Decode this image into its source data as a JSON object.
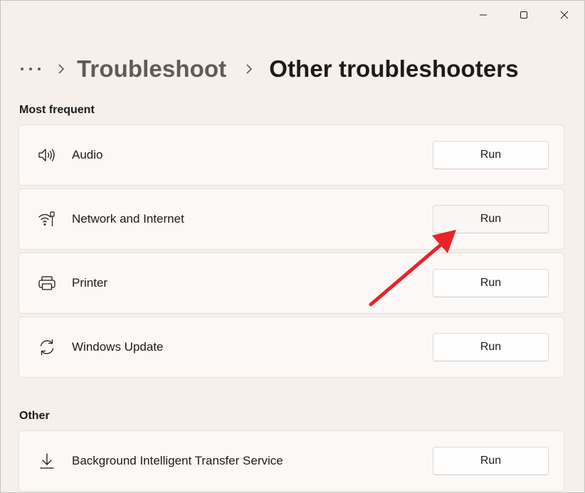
{
  "breadcrumb": {
    "parent": "Troubleshoot",
    "current": "Other troubleshooters"
  },
  "sections": {
    "most_frequent": {
      "heading": "Most frequent",
      "items": [
        {
          "label": "Audio",
          "icon": "speaker-icon",
          "button": "Run"
        },
        {
          "label": "Network and Internet",
          "icon": "wifi-ethernet-icon",
          "button": "Run"
        },
        {
          "label": "Printer",
          "icon": "printer-icon",
          "button": "Run"
        },
        {
          "label": "Windows Update",
          "icon": "refresh-icon",
          "button": "Run"
        }
      ]
    },
    "other": {
      "heading": "Other",
      "items": [
        {
          "label": "Background Intelligent Transfer Service",
          "icon": "download-icon",
          "button": "Run"
        }
      ]
    }
  },
  "annotation": {
    "arrow_color": "#e8232a"
  }
}
